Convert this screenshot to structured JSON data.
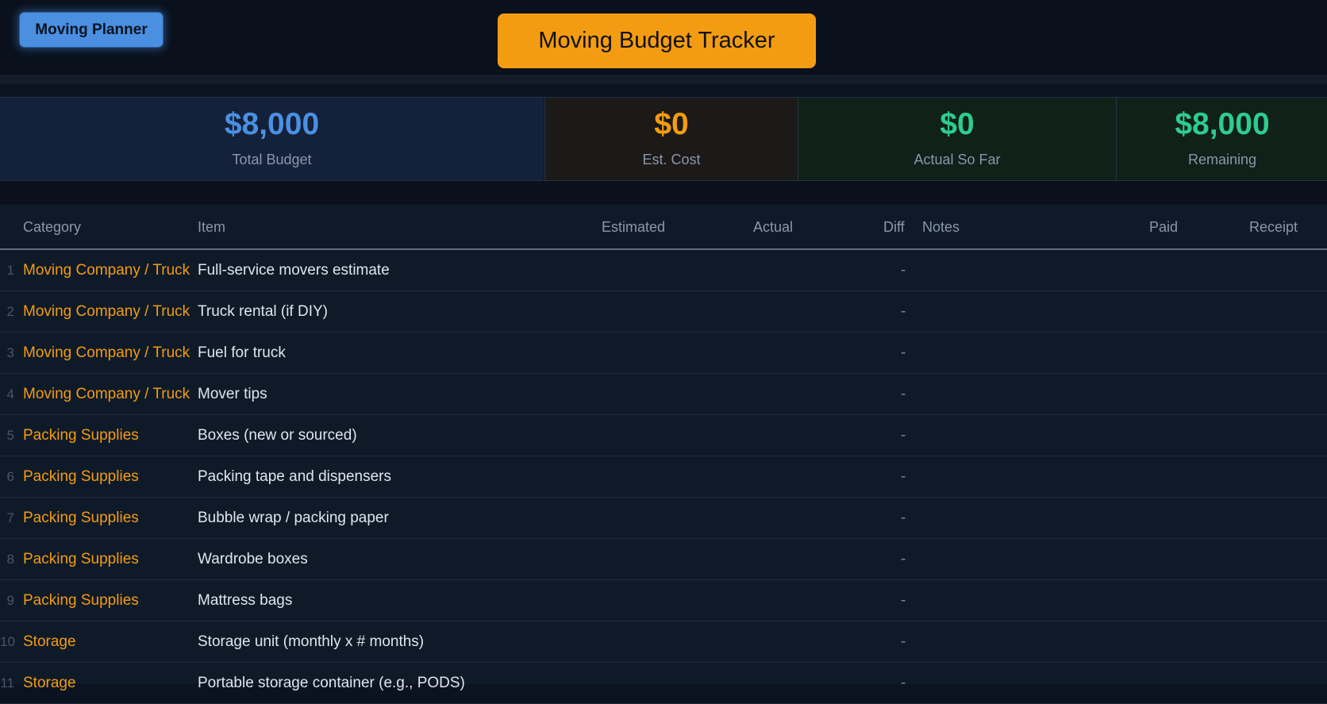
{
  "header": {
    "planner_button": "Moving Planner",
    "title": "Moving Budget Tracker"
  },
  "stats": {
    "total_budget": {
      "value": "$8,000",
      "label": "Total Budget"
    },
    "est_cost": {
      "value": "$0",
      "label": "Est. Cost"
    },
    "actual_so_far": {
      "value": "$0",
      "label": "Actual So Far"
    },
    "remaining": {
      "value": "$8,000",
      "label": "Remaining"
    }
  },
  "colors": {
    "budget": "#4a90e2",
    "est": "#f39c12",
    "actual": "#2ecc8f",
    "remaining": "#2ecc8f"
  },
  "table": {
    "columns": [
      "Category",
      "Item",
      "Estimated",
      "Actual",
      "Diff",
      "Notes",
      "Paid",
      "Receipt"
    ],
    "rows": [
      {
        "num": "1",
        "category": "Moving Company / Truck",
        "item": "Full-service movers estimate",
        "diff": "-"
      },
      {
        "num": "2",
        "category": "Moving Company / Truck",
        "item": "Truck rental (if DIY)",
        "diff": "-"
      },
      {
        "num": "3",
        "category": "Moving Company / Truck",
        "item": "Fuel for truck",
        "diff": "-"
      },
      {
        "num": "4",
        "category": "Moving Company / Truck",
        "item": "Mover tips",
        "diff": "-"
      },
      {
        "num": "5",
        "category": "Packing Supplies",
        "item": "Boxes (new or sourced)",
        "diff": "-"
      },
      {
        "num": "6",
        "category": "Packing Supplies",
        "item": "Packing tape and dispensers",
        "diff": "-"
      },
      {
        "num": "7",
        "category": "Packing Supplies",
        "item": "Bubble wrap / packing paper",
        "diff": "-"
      },
      {
        "num": "8",
        "category": "Packing Supplies",
        "item": "Wardrobe boxes",
        "diff": "-"
      },
      {
        "num": "9",
        "category": "Packing Supplies",
        "item": "Mattress bags",
        "diff": "-"
      },
      {
        "num": "10",
        "category": "Storage",
        "item": "Storage unit (monthly x # months)",
        "diff": "-"
      },
      {
        "num": "11",
        "category": "Storage",
        "item": "Portable storage container (e.g., PODS)",
        "diff": "-"
      }
    ]
  }
}
